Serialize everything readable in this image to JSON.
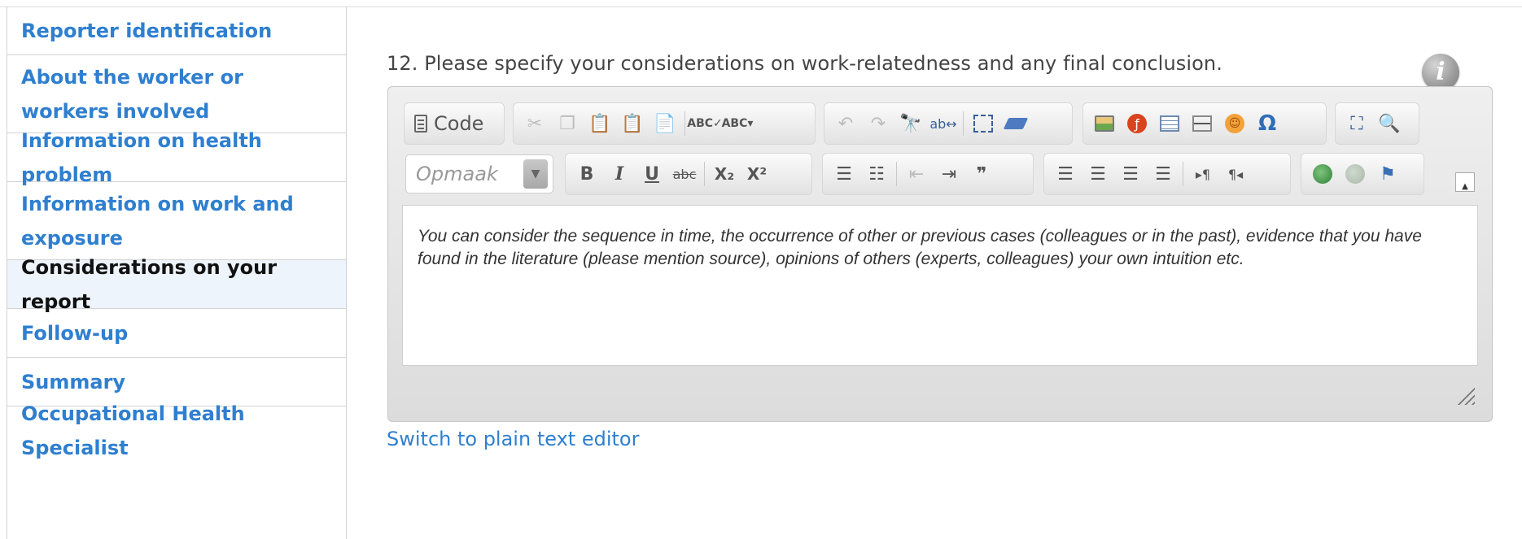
{
  "sidebar": {
    "items": [
      {
        "label": "Reporter identification"
      },
      {
        "label": "About the worker or workers involved"
      },
      {
        "label": "Information on health problem"
      },
      {
        "label": "Information on work and exposure"
      },
      {
        "label": "Considerations on your report"
      },
      {
        "label": "Follow-up"
      },
      {
        "label": "Summary"
      },
      {
        "label": "Occupational Health Specialist"
      }
    ],
    "active_index": 4
  },
  "question": {
    "text": "12. Please specify your considerations on work-relatedness and any final conclusion."
  },
  "editor": {
    "code_label": "Code",
    "format_placeholder": "Opmaak",
    "content": "You can consider the sequence in time, the occurrence of other or previous cases (colleagues or in the past), evidence that you have found in the literature (please mention source), opinions of others (experts, colleagues) your own intuition etc.",
    "icons_row1": [
      "cut-icon",
      "copy-icon",
      "paste-icon",
      "paste-text-icon",
      "paste-word-icon",
      "spellcheck-icon",
      "spellcheck-menu-icon",
      "undo-icon",
      "redo-icon",
      "find-icon",
      "replace-icon",
      "select-all-icon",
      "remove-format-icon",
      "image-icon",
      "flash-icon",
      "table-icon",
      "horizontal-rule-icon",
      "smiley-icon",
      "special-char-icon",
      "maximize-icon",
      "preview-icon"
    ],
    "icons_row2": [
      "bold-icon",
      "italic-icon",
      "underline-icon",
      "strike-icon",
      "subscript-icon",
      "superscript-icon",
      "numbered-list-icon",
      "bullet-list-icon",
      "outdent-icon",
      "indent-icon",
      "blockquote-icon",
      "align-left-icon",
      "align-center-icon",
      "align-right-icon",
      "justify-icon",
      "ltr-icon",
      "rtl-icon",
      "link-icon",
      "unlink-icon",
      "anchor-icon"
    ],
    "glyphs": {
      "bold": "B",
      "italic": "I",
      "underline": "U",
      "strike": "abc",
      "subscript": "X₂",
      "superscript": "X²",
      "omega": "Ω",
      "quote": "❞",
      "collapse": "▲"
    }
  },
  "links": {
    "switch_editor": "Switch to plain text editor"
  },
  "colors": {
    "link": "#2f7fd0",
    "active_bg": "#eef4fb"
  }
}
